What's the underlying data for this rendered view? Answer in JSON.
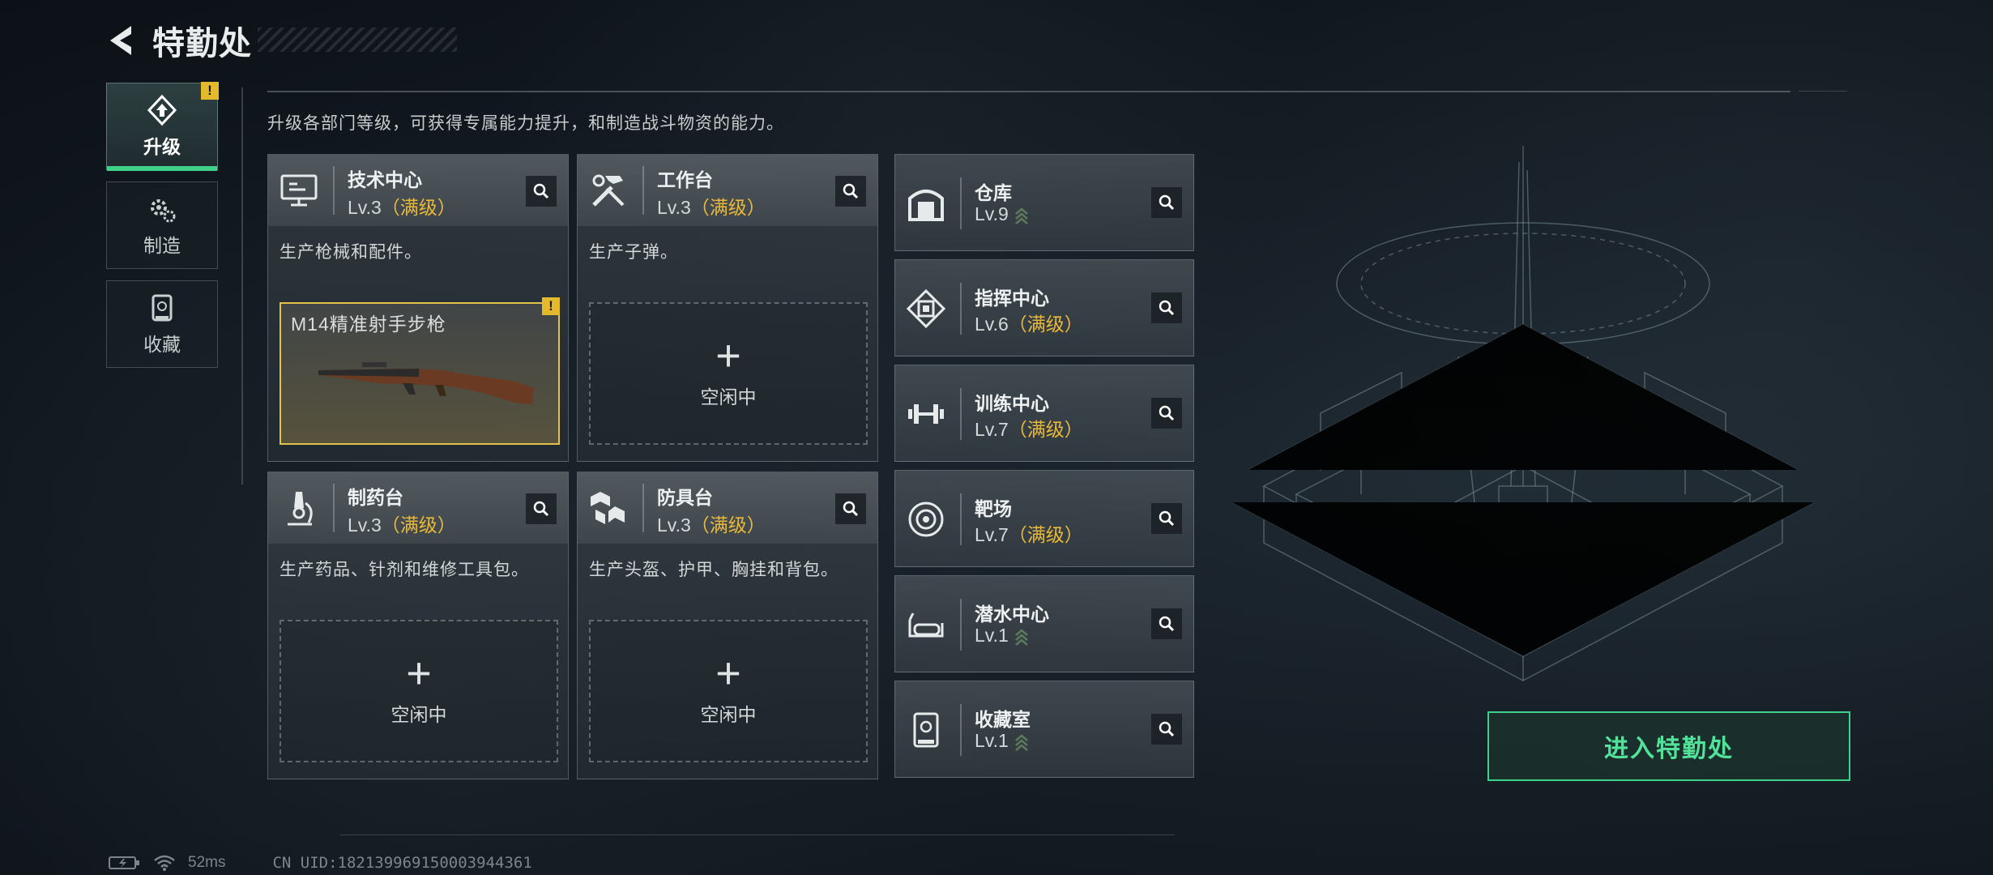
{
  "header": {
    "title": "特勤处"
  },
  "nav": [
    {
      "label": "升级",
      "active": true,
      "warning": "!"
    },
    {
      "label": "制造",
      "active": false
    },
    {
      "label": "收藏",
      "active": false
    }
  ],
  "description": "升级各部门等级，可获得专属能力提升，和制造战斗物资的能力。",
  "max_label": "（满级）",
  "departments": [
    {
      "name": "技术中心",
      "level": "Lv.3",
      "desc": "生产枪械和配件。",
      "item": {
        "name": "M14精准射手步枪",
        "warning": "!"
      }
    },
    {
      "name": "工作台",
      "level": "Lv.3",
      "desc": "生产子弹。",
      "slot": {
        "plus": "+",
        "label": "空闲中"
      }
    },
    {
      "name": "制药台",
      "level": "Lv.3",
      "desc": "生产药品、针剂和维修工具包。",
      "slot": {
        "plus": "+",
        "label": "空闲中"
      }
    },
    {
      "name": "防具台",
      "level": "Lv.3",
      "desc": "生产头盔、护甲、胸挂和背包。",
      "slot": {
        "plus": "+",
        "label": "空闲中"
      }
    }
  ],
  "facilities": [
    {
      "name": "仓库",
      "level": "Lv.9",
      "maxed": false
    },
    {
      "name": "指挥中心",
      "level": "Lv.6",
      "maxed": true
    },
    {
      "name": "训练中心",
      "level": "Lv.7",
      "maxed": true
    },
    {
      "name": "靶场",
      "level": "Lv.7",
      "maxed": true
    },
    {
      "name": "潜水中心",
      "level": "Lv.1",
      "maxed": false
    },
    {
      "name": "收藏室",
      "level": "Lv.1",
      "maxed": false
    }
  ],
  "enter_button": "进入特勤处",
  "footer": {
    "ping": "52ms",
    "uid": "CN UID:18213996915000394436​1"
  },
  "colors": {
    "accent_green": "#3fd08a",
    "max_gold": "#e9b93a",
    "warning": "#e5b92c"
  }
}
